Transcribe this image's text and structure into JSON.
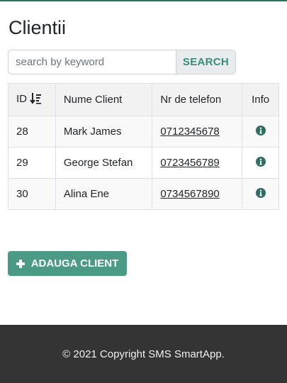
{
  "page": {
    "title": "Clientii"
  },
  "search": {
    "placeholder": "search by keyword",
    "value": "",
    "button_label": "SEARCH"
  },
  "table": {
    "headers": {
      "id": "ID",
      "name": "Nume Client",
      "phone": "Nr de telefon",
      "info": "Info"
    },
    "sort_icon": "sort-numeric-down-icon",
    "rows": [
      {
        "id": "28",
        "name": "Mark James",
        "phone": "0712345678",
        "info_icon": "info-circle-icon"
      },
      {
        "id": "29",
        "name": "George Stefan",
        "phone": "0723456789",
        "info_icon": "info-circle-icon"
      },
      {
        "id": "30",
        "name": "Alina Ene",
        "phone": "0734567890",
        "info_icon": "info-circle-icon"
      }
    ]
  },
  "add_client": {
    "label": "ADAUGA CLIENT",
    "icon": "plus-icon"
  },
  "footer": {
    "text": "© 2021 Copyright SMS SmartApp."
  },
  "colors": {
    "accent": "#4a9a86",
    "accent_text": "#3a8b78",
    "footer_bg": "#343434",
    "top_line": "#2e6f62"
  }
}
